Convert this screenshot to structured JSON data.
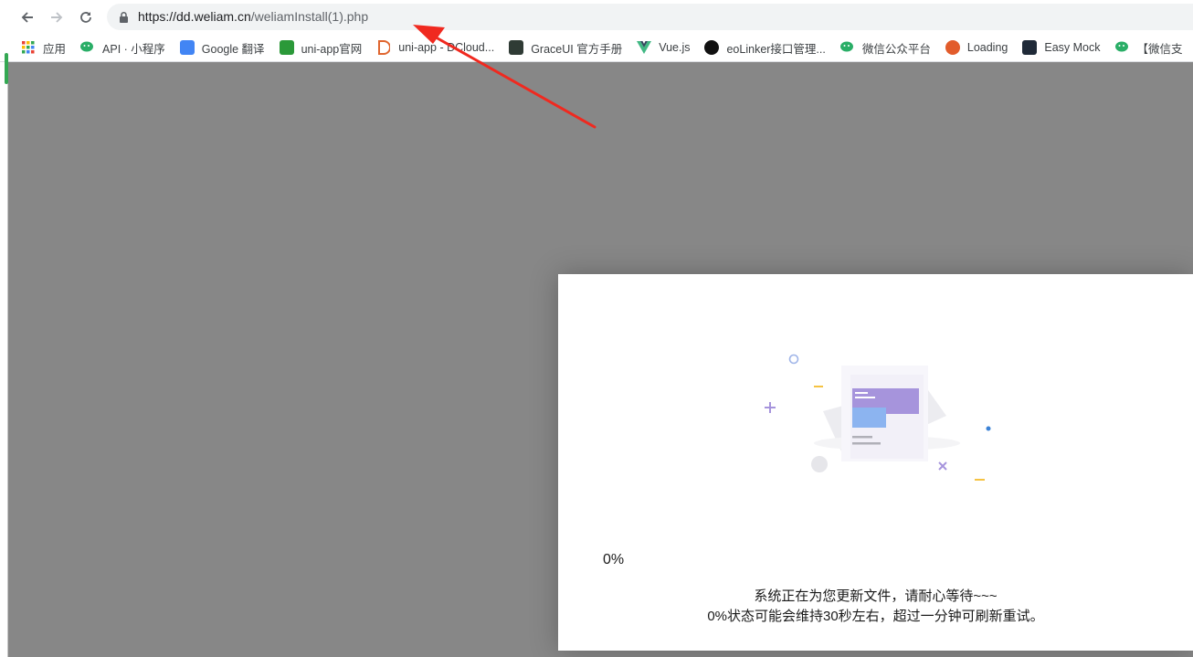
{
  "browser": {
    "url_host": "https://dd.weliam.cn",
    "url_path": "/weliamInstall(1).php",
    "bookmarks": [
      {
        "label": "应用",
        "icon": "apps-grid-icon",
        "color": "#4285f4"
      },
      {
        "label": "API · 小程序",
        "icon": "wechat-icon",
        "color": "#2aae67"
      },
      {
        "label": "Google 翻译",
        "icon": "google-translate-icon",
        "color": "#4285f4"
      },
      {
        "label": "uni-app官网",
        "icon": "uniapp-icon",
        "color": "#2b9939"
      },
      {
        "label": "uni-app - DCloud...",
        "icon": "dcloud-icon",
        "color": "#e0662f"
      },
      {
        "label": "GraceUI 官方手册",
        "icon": "graceui-icon",
        "color": "#2f3b35"
      },
      {
        "label": "Vue.js",
        "icon": "vue-icon",
        "color": "#41b883"
      },
      {
        "label": "eoLinker接口管理...",
        "icon": "eolinker-icon",
        "color": "#111111"
      },
      {
        "label": "微信公众平台",
        "icon": "wechat-icon",
        "color": "#2aae67"
      },
      {
        "label": "Loading",
        "icon": "loading-icon",
        "color": "#e25c2b"
      },
      {
        "label": "Easy Mock",
        "icon": "easymock-icon",
        "color": "#1f2a38"
      },
      {
        "label": "【微信支",
        "icon": "wechat-icon",
        "color": "#2aae67"
      }
    ]
  },
  "modal": {
    "progress_text": "0%",
    "progress": 0,
    "message_line1": "系统正在为您更新文件，请耐心等待~~~",
    "message_line2": "0%状态可能会维持30秒左右，超过一分钟可刷新重试。"
  },
  "colors": {
    "overlay": "#878787",
    "arrow": "#f0291f",
    "illustration_purple": "#a694dc",
    "illustration_blue": "#8cb4f0"
  }
}
